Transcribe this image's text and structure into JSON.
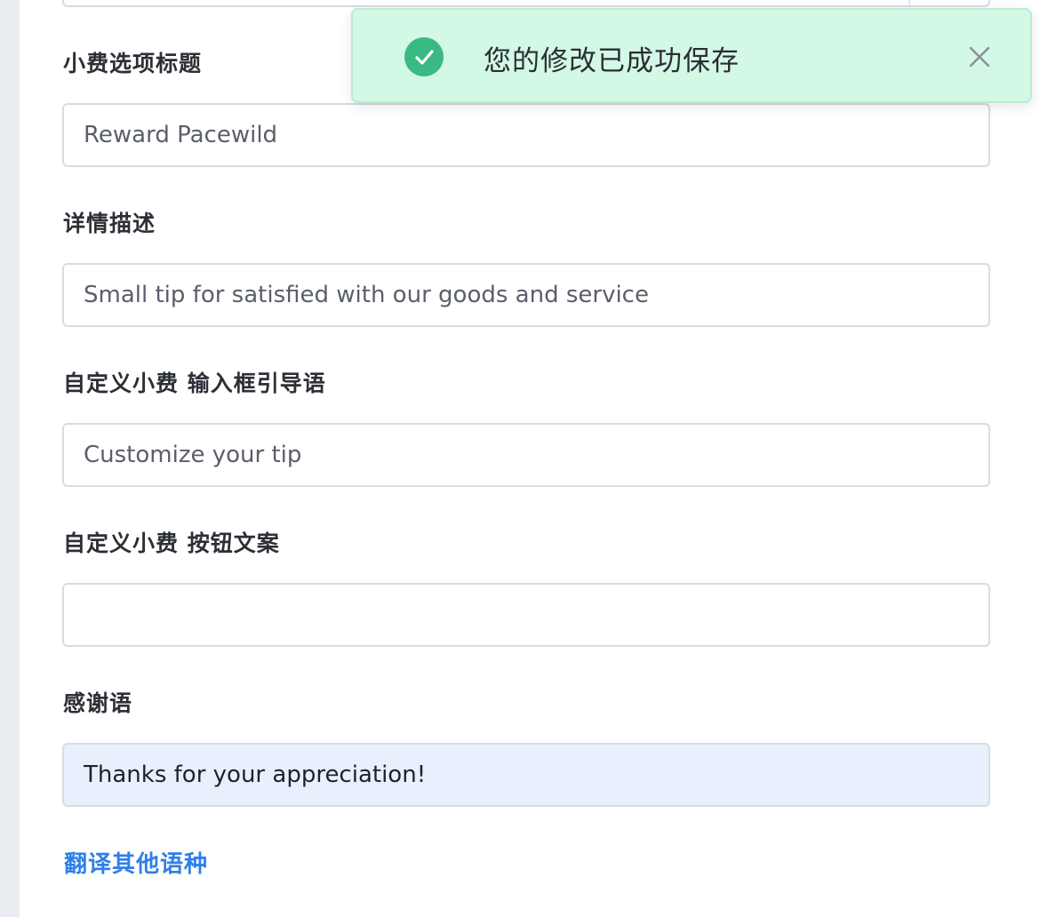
{
  "form": {
    "tip_title_label": "小费选项标题",
    "tip_title_value": "Reward Pacewild",
    "description_label": "详情描述",
    "description_value": "Small tip for satisfied with our goods and service",
    "custom_input_placeholder_label": "自定义小费 输入框引导语",
    "custom_input_placeholder_value": "Customize your tip",
    "custom_button_text_label": "自定义小费 按钮文案",
    "custom_button_text_value": "",
    "thanks_label": "感谢语",
    "thanks_value": "Thanks for your appreciation!",
    "translate_link": "翻译其他语种"
  },
  "toast": {
    "message": "您的修改已成功保存",
    "icon": "check-circle-icon",
    "close_icon": "close-icon",
    "accent_color": "#3bb983",
    "background_color": "#d3f8e6"
  },
  "colors": {
    "link": "#2f7fe8",
    "filled_field_bg": "#e8f0fe"
  }
}
